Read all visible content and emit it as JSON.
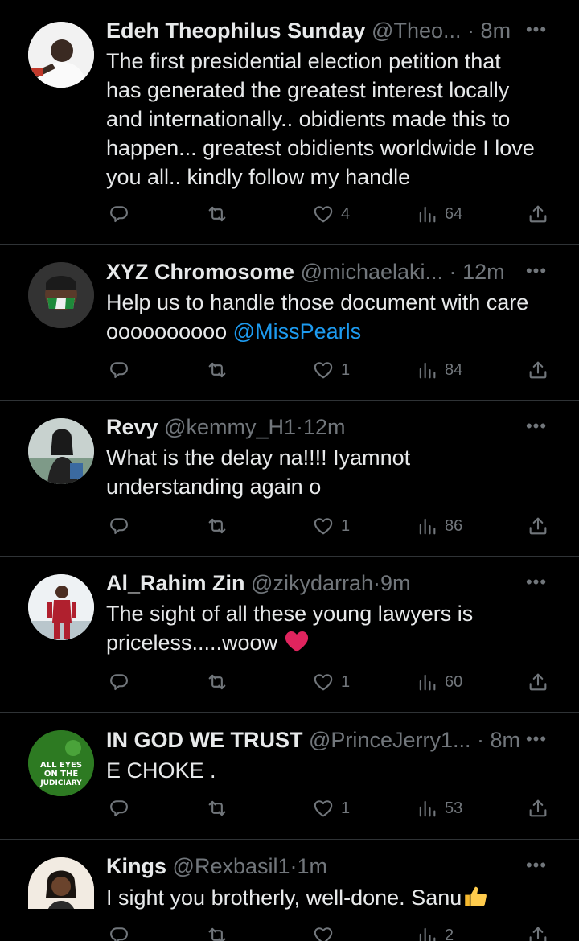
{
  "tweets": [
    {
      "name": "Edeh Theophilus Sunday",
      "handle": "@Theo...",
      "dot": "·",
      "time": "8m",
      "text_lines": [
        "The first presidential election petition that",
        "has generated the greatest interest locally",
        "and internationally.. obidients made this to",
        "happen... greatest obidients worldwide I love",
        "you all.. kindly follow my handle"
      ],
      "likes": "4",
      "views": "64"
    },
    {
      "name": "XYZ Chromosome",
      "handle": "@michaelaki...",
      "dot": "·",
      "time": "12m",
      "text_line1": "Help us to handle those document with care",
      "text_line2_plain": "oooooooooo ",
      "mention": "@MissPearls",
      "likes": "1",
      "views": "84"
    },
    {
      "name": "Revy",
      "handle": "@kemmy_H1",
      "dot": "·",
      "time": "12m",
      "text_lines": [
        "What is the delay na!!!! Iyamnot",
        "understanding again o"
      ],
      "likes": "1",
      "views": "86"
    },
    {
      "name": "Al_Rahim Zin",
      "handle": "@zikydarrah",
      "dot": "·",
      "time": "9m",
      "text_line1": "The sight of all these young lawyers is",
      "text_line2": "priceless.....woow ",
      "emoji": "red-heart-emoji",
      "likes": "1",
      "views": "60"
    },
    {
      "name": "IN GOD WE TRUST",
      "handle": "@PrinceJerry1...",
      "dot": "·",
      "time": "8m",
      "text_lines": [
        "E CHOKE ."
      ],
      "avatar_text": [
        "ALL EYES",
        "ON THE",
        "JUDICIARY"
      ],
      "likes": "1",
      "views": "53"
    },
    {
      "name": "Kings",
      "handle": "@Rexbasil1",
      "dot": "·",
      "time": "1m",
      "text": "I sight you brotherly, well-done. Sanu",
      "emoji": "thumbs-up-emoji",
      "likes": "",
      "views": "2"
    }
  ],
  "icons": {
    "reply": "reply-icon",
    "retweet": "retweet-icon",
    "like": "heart-icon",
    "views": "views-icon",
    "share": "share-icon",
    "more": "more-icon"
  },
  "colors": {
    "background": "#000000",
    "text": "#e7e9ea",
    "secondary": "#71767b",
    "link": "#1d9bf0",
    "divider": "#2f3336"
  },
  "more_label": "•••"
}
